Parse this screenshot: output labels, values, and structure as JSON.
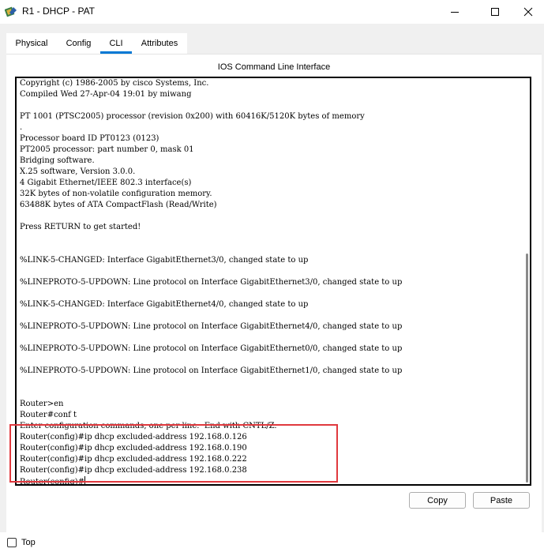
{
  "window": {
    "title": "R1 - DHCP - PAT",
    "icon": "router-icon"
  },
  "tabs": [
    {
      "label": "Physical",
      "active": false
    },
    {
      "label": "Config",
      "active": false
    },
    {
      "label": "CLI",
      "active": true
    },
    {
      "label": "Attributes",
      "active": false
    }
  ],
  "panel": {
    "title": "IOS Command Line Interface"
  },
  "terminal": {
    "lines": [
      "Copyright (c) 1986-2005 by cisco Systems, Inc.",
      "Compiled Wed 27-Apr-04 19:01 by miwang",
      "",
      "PT 1001 (PTSC2005) processor (revision 0x200) with 60416K/5120K bytes of memory",
      ".",
      "Processor board ID PT0123 (0123)",
      "PT2005 processor: part number 0, mask 01",
      "Bridging software.",
      "X.25 software, Version 3.0.0.",
      "4 Gigabit Ethernet/IEEE 802.3 interface(s)",
      "32K bytes of non-volatile configuration memory.",
      "63488K bytes of ATA CompactFlash (Read/Write)",
      "",
      "Press RETURN to get started!",
      "",
      "",
      "%LINK-5-CHANGED: Interface GigabitEthernet3/0, changed state to up",
      "",
      "%LINEPROTO-5-UPDOWN: Line protocol on Interface GigabitEthernet3/0, changed state to up",
      "",
      "%LINK-5-CHANGED: Interface GigabitEthernet4/0, changed state to up",
      "",
      "%LINEPROTO-5-UPDOWN: Line protocol on Interface GigabitEthernet4/0, changed state to up",
      "",
      "%LINEPROTO-5-UPDOWN: Line protocol on Interface GigabitEthernet0/0, changed state to up",
      "",
      "%LINEPROTO-5-UPDOWN: Line protocol on Interface GigabitEthernet1/0, changed state to up",
      "",
      "",
      "Router>en",
      "Router#conf t",
      "Enter configuration commands, one per line.  End with CNTL/Z.",
      "Router(config)#ip dhcp excluded-address 192.168.0.126",
      "Router(config)#ip dhcp excluded-address 192.168.0.190",
      "Router(config)#ip dhcp excluded-address 192.168.0.222",
      "Router(config)#ip dhcp excluded-address 192.168.0.238",
      "Router(config)#"
    ]
  },
  "buttons": {
    "copy": "Copy",
    "paste": "Paste"
  },
  "bottom": {
    "top_label": "Top",
    "top_checked": false
  },
  "colors": {
    "active_tab_underline": "#0078d4",
    "highlight_box": "#e0393e"
  }
}
